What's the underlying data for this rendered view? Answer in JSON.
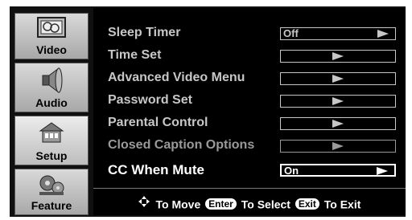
{
  "sidebar": {
    "items": [
      {
        "label": "Video",
        "icon": "video-icon"
      },
      {
        "label": "Audio",
        "icon": "speaker-icon"
      },
      {
        "label": "Setup",
        "icon": "setup-icon"
      },
      {
        "label": "Feature",
        "icon": "feature-icon"
      }
    ]
  },
  "menu": {
    "rows": [
      {
        "label": "Sleep Timer",
        "value": "Off"
      },
      {
        "label": "Time Set",
        "value": ""
      },
      {
        "label": "Advanced Video Menu",
        "value": ""
      },
      {
        "label": "Password Set",
        "value": ""
      },
      {
        "label": "Parental Control",
        "value": ""
      },
      {
        "label": "Closed Caption Options",
        "value": ""
      },
      {
        "label": "CC When Mute",
        "value": "On"
      }
    ]
  },
  "hint": {
    "move": "To Move",
    "enter_key": "Enter",
    "select": "To Select",
    "exit_key": "Exit",
    "exit": "To Exit"
  }
}
